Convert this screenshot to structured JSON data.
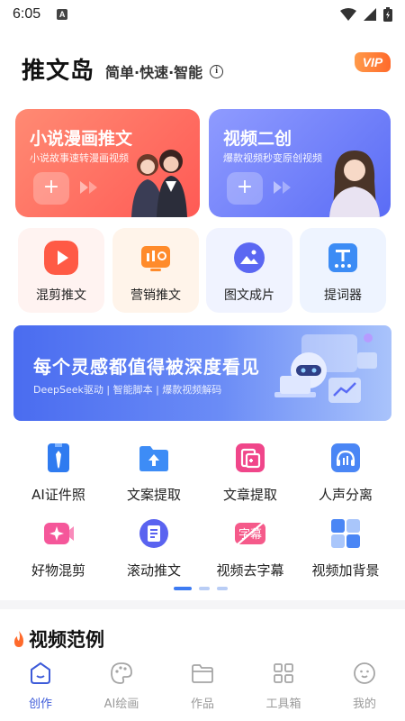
{
  "status_bar": {
    "time": "6:05",
    "notification": "A"
  },
  "header": {
    "app_name": "推文岛",
    "slogan": "简单·快速·智能",
    "vip": "VIP"
  },
  "feature_cards": [
    {
      "title": "小说漫画推文",
      "subtitle": "小说故事速转漫画视频"
    },
    {
      "title": "视频二创",
      "subtitle": "爆款视频秒变原创视频"
    }
  ],
  "quick_tools": [
    {
      "label": "混剪推文",
      "icon": "play-icon"
    },
    {
      "label": "营销推文",
      "icon": "marketing-icon"
    },
    {
      "label": "图文成片",
      "icon": "image-icon"
    },
    {
      "label": "提词器",
      "icon": "teleprompter-icon"
    }
  ],
  "banner": {
    "title": "每个灵感都值得被深度看见",
    "subtitle": "DeepSeek驱动 | 智能脚本 | 爆款视频解码"
  },
  "tools": [
    {
      "label": "AI证件照",
      "icon": "id-photo-icon"
    },
    {
      "label": "文案提取",
      "icon": "folder-upload-icon"
    },
    {
      "label": "文章提取",
      "icon": "article-icon"
    },
    {
      "label": "人声分离",
      "icon": "audio-separate-icon"
    },
    {
      "label": "好物混剪",
      "icon": "video-cut-icon"
    },
    {
      "label": "滚动推文",
      "icon": "scroll-text-icon"
    },
    {
      "label": "视频去字幕",
      "icon": "remove-subtitle-icon"
    },
    {
      "label": "视频加背景",
      "icon": "add-background-icon"
    }
  ],
  "section": {
    "title": "视频范例"
  },
  "bottom_nav": [
    {
      "label": "创作",
      "active": true
    },
    {
      "label": "AI绘画",
      "active": false
    },
    {
      "label": "作品",
      "active": false
    },
    {
      "label": "工具箱",
      "active": false
    },
    {
      "label": "我的",
      "active": false
    }
  ],
  "colors": {
    "accent": "#3d5bd9",
    "novel_card": "#ff6b5f",
    "video_card": "#6f7cf7"
  }
}
